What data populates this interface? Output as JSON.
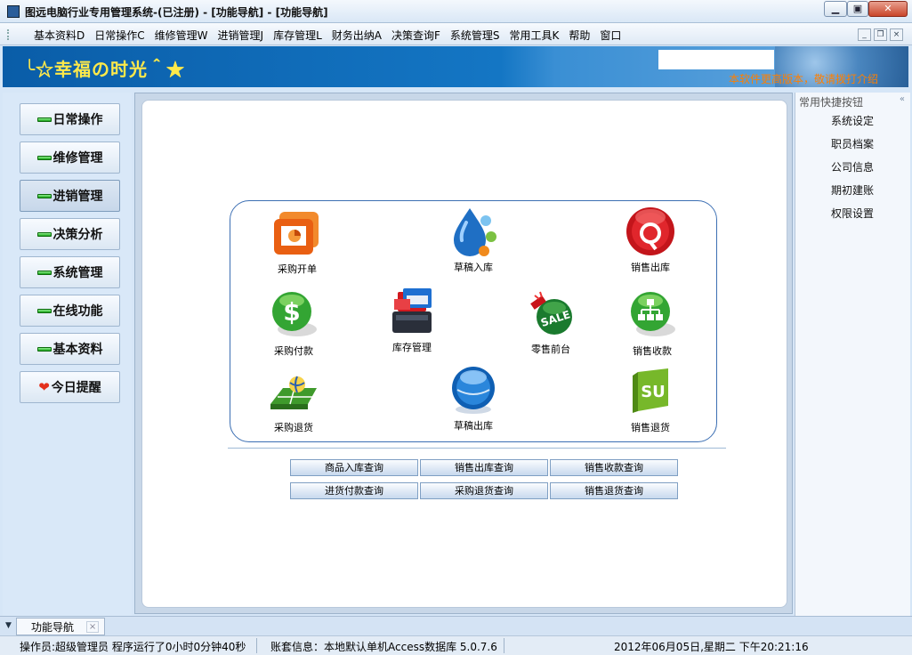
{
  "window": {
    "title": "图远电脑行业专用管理系统-(已注册) - [功能导航] - [功能导航]",
    "min_icon": "minimize-icon",
    "max_icon": "maximize-icon",
    "close_icon": "close-icon"
  },
  "menu": {
    "items": [
      "基本资料D",
      "日常操作C",
      "维修管理W",
      "进销管理J",
      "库存管理L",
      "财务出纳A",
      "决策查询F",
      "系统管理S",
      "常用工具K",
      "帮助",
      "窗口"
    ]
  },
  "banner": {
    "slogan": "╰☆幸福の时光＾★",
    "marquee": "本软件更高版本，敬请拨打介绍"
  },
  "leftnav": {
    "items": [
      {
        "label": "日常操作",
        "icon": "green-led-icon"
      },
      {
        "label": "维修管理",
        "icon": "green-led-icon"
      },
      {
        "label": "进销管理",
        "icon": "green-led-icon",
        "active": true
      },
      {
        "label": "决策分析",
        "icon": "green-led-icon"
      },
      {
        "label": "系统管理",
        "icon": "green-led-icon"
      },
      {
        "label": "在线功能",
        "icon": "green-led-icon"
      },
      {
        "label": "基本资料",
        "icon": "green-led-icon"
      },
      {
        "label": "今日提醒",
        "icon": "heart-icon"
      }
    ]
  },
  "functions": {
    "purchase_order": "采购开单",
    "draft_in": "草稿入库",
    "sales_out": "销售出库",
    "purchase_pay": "采购付款",
    "inventory": "库存管理",
    "retail": "零售前台",
    "sales_receipt": "销售收款",
    "purchase_return": "采购退货",
    "draft_out": "草稿出库",
    "sales_return": "销售退货"
  },
  "queries": {
    "row1": [
      "商品入库查询",
      "销售出库查询",
      "销售收款查询"
    ],
    "row2": [
      "进货付款查询",
      "采购退货查询",
      "销售退货查询"
    ]
  },
  "quickpanel": {
    "title": "常用快捷按钮",
    "collapse_icon": "double-chevron-left-icon",
    "items": [
      "系统设定",
      "职员档案",
      "公司信息",
      "期初建账",
      "权限设置"
    ]
  },
  "tabs": {
    "active": "功能导航"
  },
  "status": {
    "operator": "操作员:超级管理员 程序运行了0小时0分钟40秒",
    "account": "账套信息：本地默认单机Access数据库 5.0.7.6",
    "datetime": "2012年06月05日,星期二  下午20:21:16"
  },
  "colors": {
    "banner": "#0a5da8",
    "slogan": "#ffe94a",
    "accent_border": "#3c6fb3"
  }
}
